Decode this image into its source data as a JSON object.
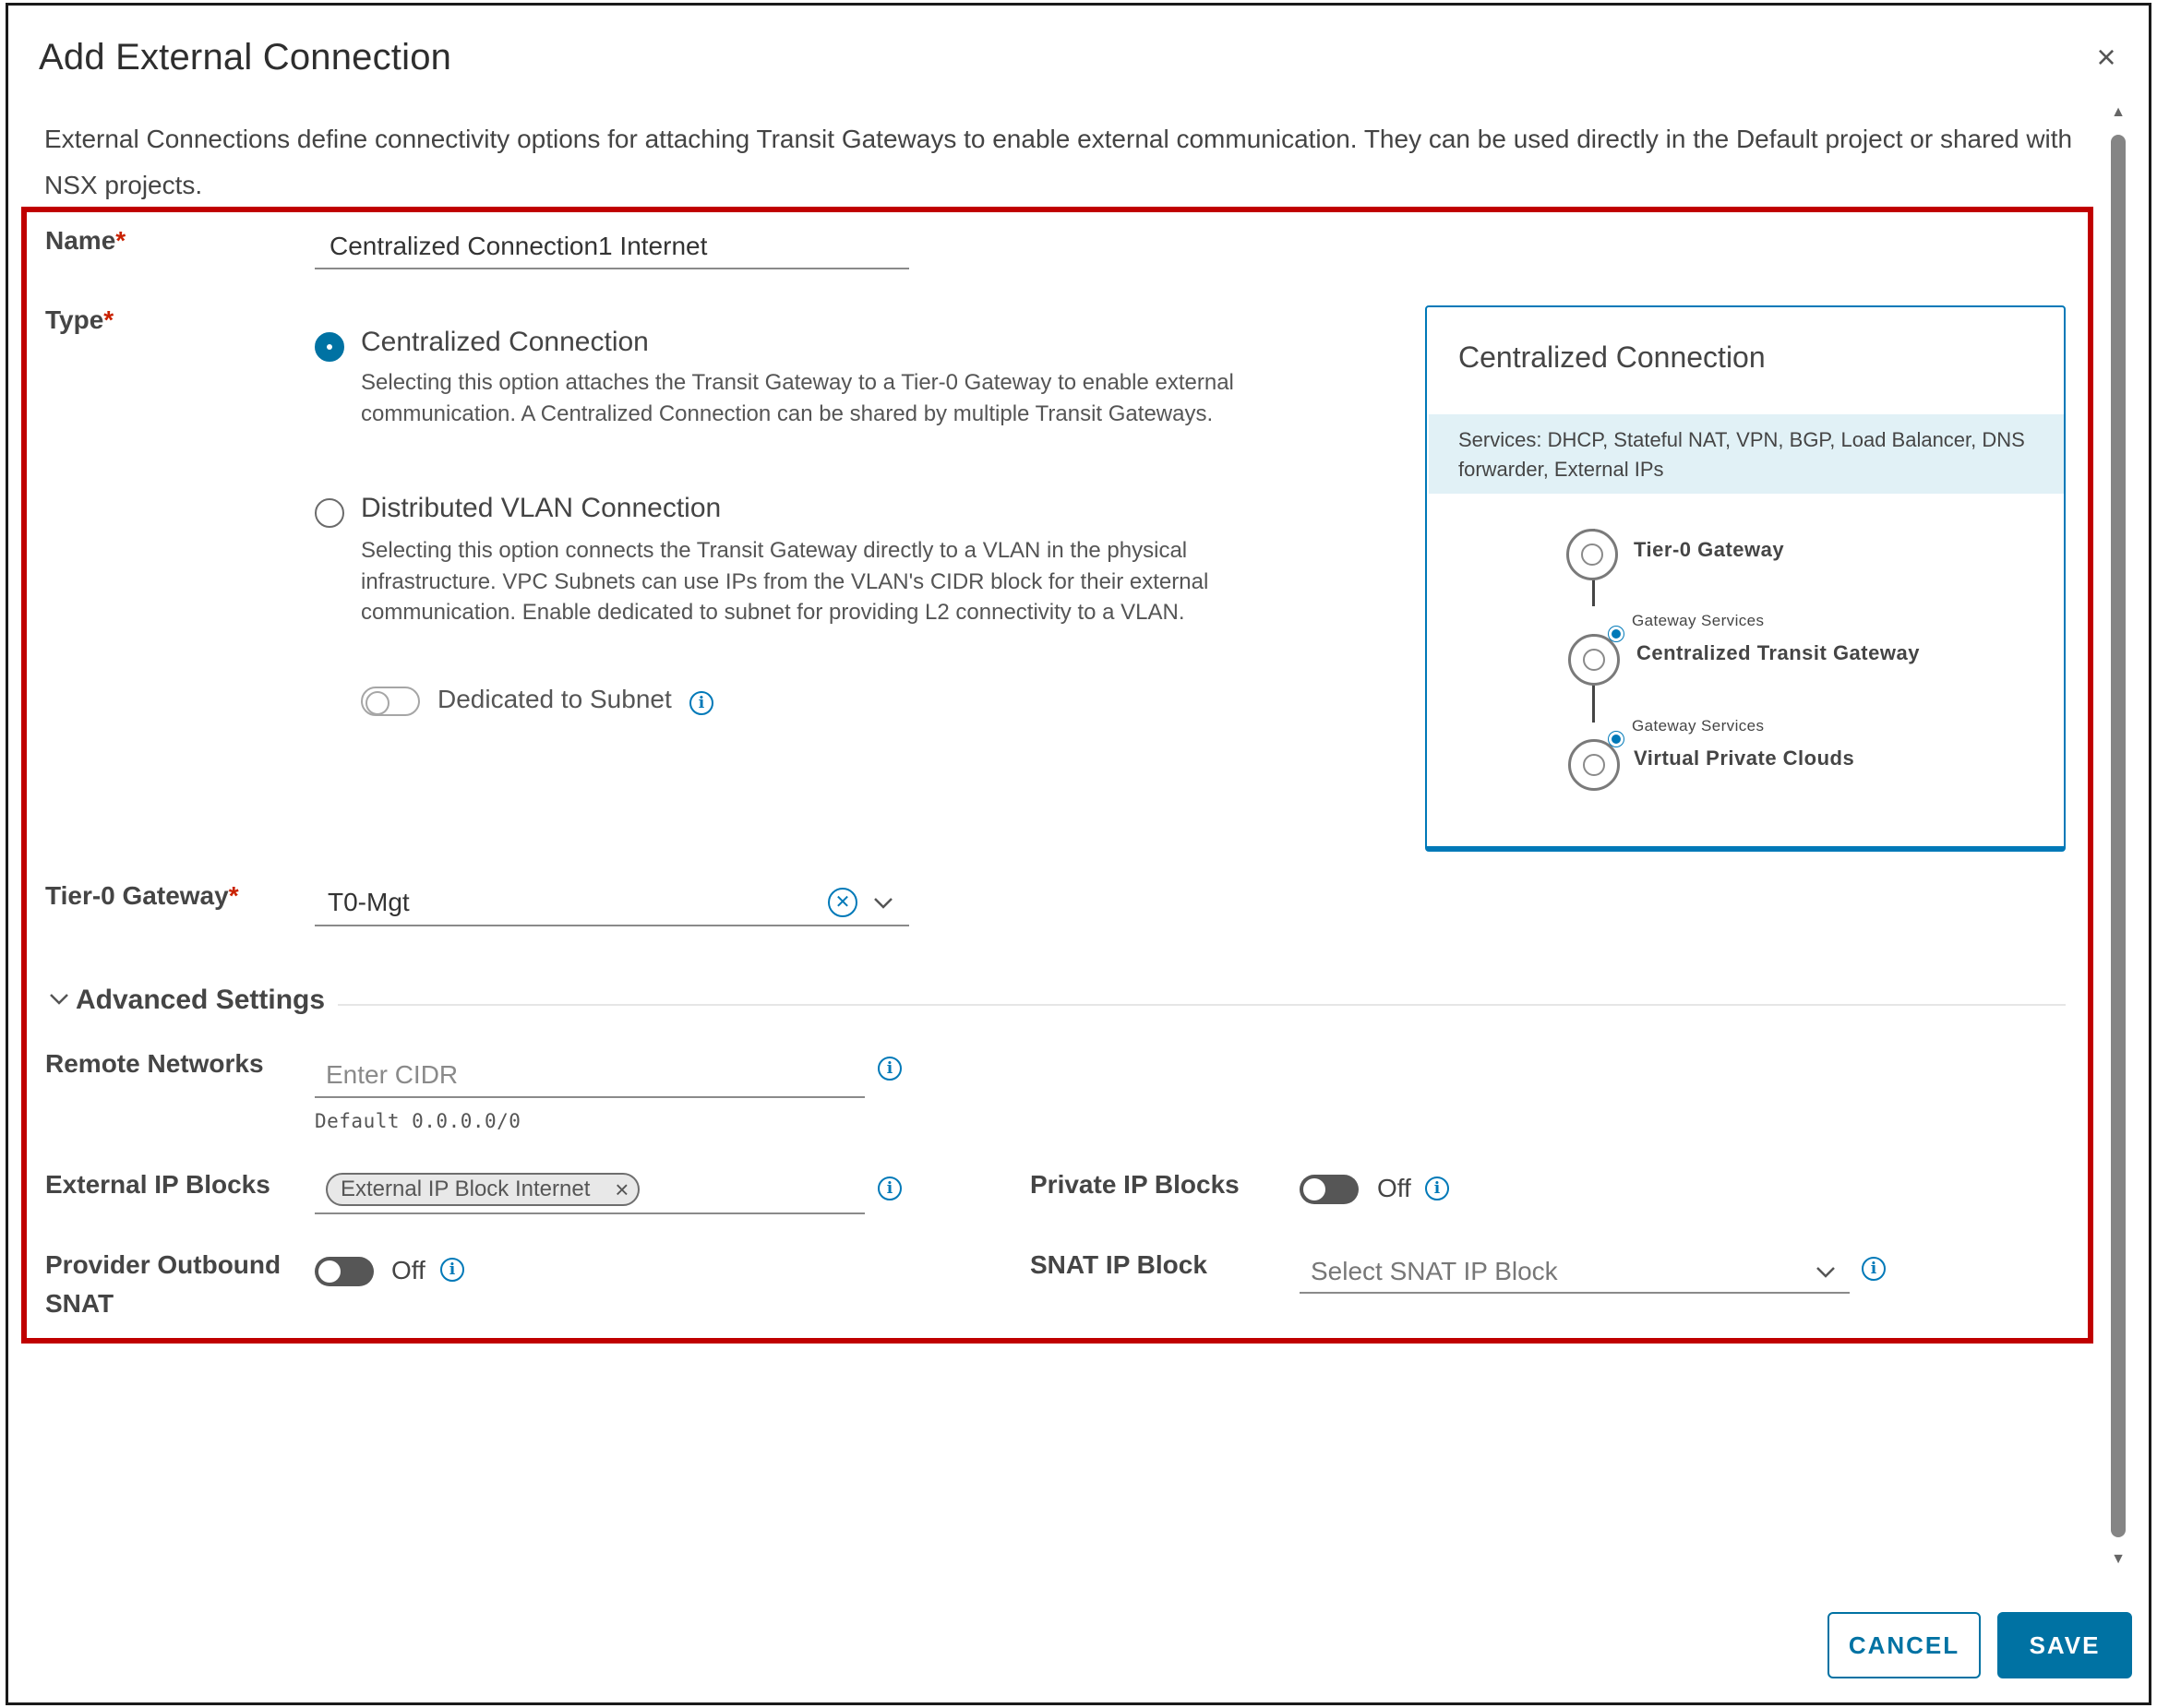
{
  "dialog": {
    "title": "Add External Connection",
    "close_glyph": "×",
    "description": "External Connections define connectivity options for attaching Transit Gateways to enable external communication. They can be used directly in the Default project or shared with NSX projects."
  },
  "form": {
    "name": {
      "label": "Name",
      "required_mark": "*",
      "value": "Centralized Connection1 Internet"
    },
    "type": {
      "label": "Type",
      "required_mark": "*",
      "options": [
        {
          "title": "Centralized Connection",
          "description": "Selecting this option attaches the Transit Gateway to a Tier-0 Gateway to enable external communication. A Centralized Connection can be shared by multiple Transit Gateways.",
          "selected": true
        },
        {
          "title": "Distributed VLAN Connection",
          "description": "Selecting this option connects the Transit Gateway directly to a VLAN in the physical infrastructure. VPC Subnets can use IPs from the VLAN's CIDR block for their external communication. Enable dedicated to subnet for providing L2 connectivity to a VLAN.",
          "selected": false
        }
      ],
      "dedicated_to_subnet_label": "Dedicated to Subnet"
    },
    "tier0": {
      "label": "Tier-0 Gateway",
      "required_mark": "*",
      "value": "T0-Mgt"
    },
    "advanced": {
      "title": "Advanced Settings",
      "remote_networks": {
        "label": "Remote Networks",
        "placeholder": "Enter CIDR",
        "hint": "Default 0.0.0.0/0"
      },
      "external_ip_blocks": {
        "label": "External IP Blocks",
        "chip": "External IP Block Internet"
      },
      "private_ip_blocks": {
        "label": "Private IP Blocks",
        "state": "Off"
      },
      "provider_outbound_snat": {
        "label_line1": "Provider Outbound",
        "label_line2": "SNAT",
        "state": "Off"
      },
      "snat_ip_block": {
        "label": "SNAT IP Block",
        "placeholder": "Select SNAT IP Block"
      }
    }
  },
  "card": {
    "title": "Centralized Connection",
    "services": "Services: DHCP, Stateful NAT, VPN, BGP, Load Balancer, DNS forwarder, External IPs",
    "nodes": [
      {
        "label": "Tier-0 Gateway",
        "caption": ""
      },
      {
        "label": "Centralized Transit Gateway",
        "caption": "Gateway Services"
      },
      {
        "label": "Virtual Private Clouds",
        "caption": "Gateway Services"
      }
    ]
  },
  "footer": {
    "cancel_label": "CANCEL",
    "save_label": "SAVE"
  },
  "colors": {
    "accent": "#0072a3",
    "highlight_border": "#c00000",
    "required": "#c92100",
    "card_services_bg": "#e1f1f6"
  }
}
